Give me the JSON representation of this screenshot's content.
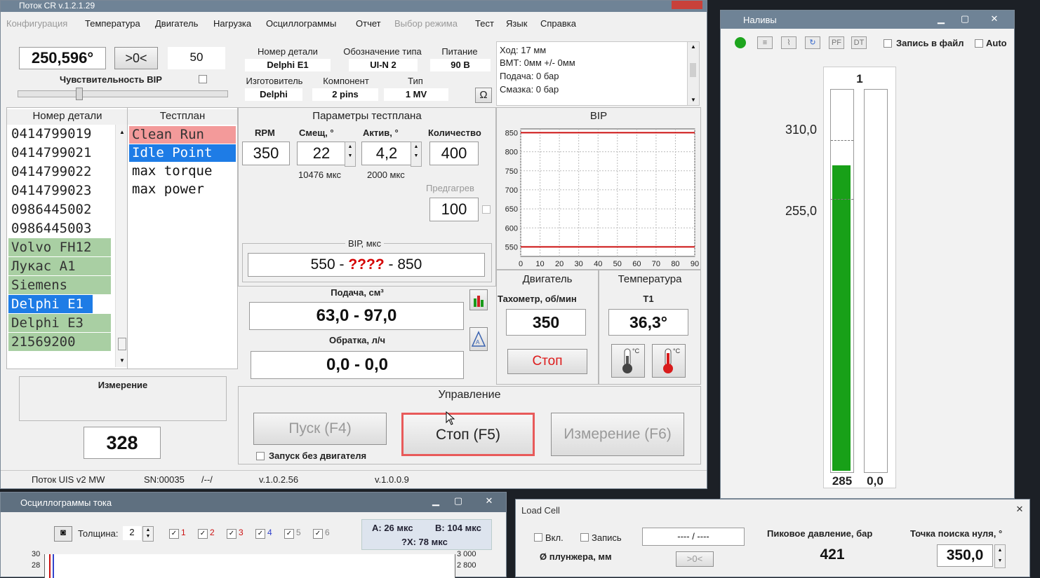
{
  "main_window": {
    "title": "Поток CR v.1.2.1.29",
    "menu": [
      "Конфигурация",
      "Температура",
      "Двигатель",
      "Нагрузка",
      "Осциллограммы",
      "Отчет",
      "Выбор режима",
      "Тест",
      "Язык",
      "Справка"
    ],
    "angle_display": "250,596°",
    "zero_button": ">0<",
    "sensitivity_value": "50",
    "sensitivity_label": "Чувствительность ВІР",
    "part_info": {
      "part_number_label": "Номер детали",
      "part_number": "Delphi E1",
      "type_label": "Обозначение типа",
      "type": "UI-N 2",
      "power_label": "Питание",
      "power": "90 В",
      "maker_label": "Изготовитель",
      "maker": "Delphi",
      "component_label": "Компонент",
      "component": "2 pins",
      "kind_label": "Тип",
      "kind": "1 MV",
      "ohm_button": "Ω"
    },
    "info_lines": [
      "Ход: 17 мм",
      "ВМТ: 0мм +/- 0мм",
      "Подача: 0 бар",
      "Смазка: 0 бар"
    ],
    "parts_header": "Номер детали",
    "parts": [
      {
        "label": "0414799019",
        "style": "normal"
      },
      {
        "label": "0414799021",
        "style": "normal"
      },
      {
        "label": "0414799022",
        "style": "normal"
      },
      {
        "label": "0414799023",
        "style": "normal"
      },
      {
        "label": "0986445002",
        "style": "normal"
      },
      {
        "label": "0986445003",
        "style": "normal"
      },
      {
        "label": "Volvo FH12",
        "style": "green"
      },
      {
        "label": "Лукас А1",
        "style": "green"
      },
      {
        "label": "Siemens",
        "style": "green"
      },
      {
        "label": "Delphi E1",
        "style": "selected"
      },
      {
        "label": "Delphi E3",
        "style": "green"
      },
      {
        "label": "21569200",
        "style": "green"
      }
    ],
    "testplan_header": "Тестплан",
    "testplan": [
      {
        "label": "Clean Run",
        "style": "red"
      },
      {
        "label": "Idle Point",
        "style": "selected"
      },
      {
        "label": "max torque",
        "style": "normal"
      },
      {
        "label": "max power",
        "style": "normal"
      }
    ],
    "params": {
      "header": "Параметры тестплана",
      "rpm_label": "RPM",
      "rpm": "350",
      "offset_label": "Смещ, °",
      "offset": "22",
      "offset_sub": "10476 мкс",
      "active_label": "Актив, °",
      "active": "4,2",
      "active_sub": "2000 мкс",
      "count_label": "Количество",
      "count": "400",
      "preheat_label": "Предгагрев",
      "preheat": "100",
      "bip_label": "ВІР, мкс",
      "bip_low": "550",
      "bip_sep1": " - ",
      "bip_mid": "????",
      "bip_sep2": " - ",
      "bip_high": "850",
      "feed_label": "Подача, см³",
      "feed": "63,0 - 97,0",
      "return_label": "Обратка, л/ч",
      "return": "0,0 - 0,0"
    },
    "bip_chart_title": "ВІР",
    "engine": {
      "header": "Двигатель",
      "tacho_label": "Тахометр, об/мин",
      "tacho": "350",
      "stop_button": "Стоп"
    },
    "temperature": {
      "header": "Температура",
      "t1_label": "T1",
      "t1": "36,3°"
    },
    "measurement": {
      "label": "Измерение",
      "value": "328"
    },
    "control": {
      "header": "Управление",
      "start_button": "Пуск (F4)",
      "stop_button": "Стоп (F5)",
      "measure_button": "Измерение (F6)",
      "no_engine_label": "Запуск без двигателя"
    },
    "status": [
      "Поток UIS v2 MW",
      "SN:00035",
      "/--/",
      "v.1.0.2.56",
      "v.1.0.0.9"
    ]
  },
  "chart_data": {
    "type": "line",
    "title": "ВІР",
    "xlim": [
      0,
      90
    ],
    "ylim": [
      525,
      860
    ],
    "xticks": [
      0,
      10,
      20,
      30,
      40,
      50,
      60,
      70,
      80,
      90
    ],
    "yticks": [
      550,
      600,
      650,
      700,
      750,
      800,
      850
    ],
    "grid": true,
    "series": [
      {
        "x": [
          0,
          90
        ],
        "values": [
          850,
          850
        ],
        "color": "#cc1111"
      },
      {
        "x": [
          0,
          90
        ],
        "values": [
          550,
          550
        ],
        "color": "#cc1111"
      }
    ]
  },
  "nalivy": {
    "title": "Наливы",
    "record_label": "Запись в файл",
    "auto_label": "Auto",
    "tool_pf": "PF",
    "tool_dt": "DT",
    "column_title": "1",
    "tick_upper": "310,0",
    "tick_lower": "255,0",
    "bar_value": "285",
    "bar2_value": "0,0",
    "bar_fill_fraction": 0.805,
    "bar_color": "#18a018"
  },
  "oscillo": {
    "title": "Осциллограммы тока",
    "thickness_label": "Толщина:",
    "thickness": "2",
    "channels": [
      "1",
      "2",
      "3",
      "4",
      "5",
      "6"
    ],
    "channel_colors": [
      "#cc1111",
      "#cc1111",
      "#cc1111",
      "#3344cc",
      "#888888",
      "#888888"
    ],
    "a_label": "A: 26 мкс",
    "b_label": "B: 104 мкс",
    "dx_label": "?X: 78 мкс",
    "y_left": [
      "30",
      "28"
    ],
    "y_right": [
      "3 000",
      "2 800"
    ]
  },
  "loadcell": {
    "title": "Load Cell",
    "enable_label": "Вкл.",
    "record_label": "Запись",
    "range_text": "---- / ----",
    "plunger_label": "Ø плунжера, мм",
    "zero_button": ">0<",
    "peak_label": "Пиковое давление, бар",
    "peak_value": "421",
    "zero_search_label": "Точка поиска нуля, °",
    "zero_search_value": "350,0"
  }
}
